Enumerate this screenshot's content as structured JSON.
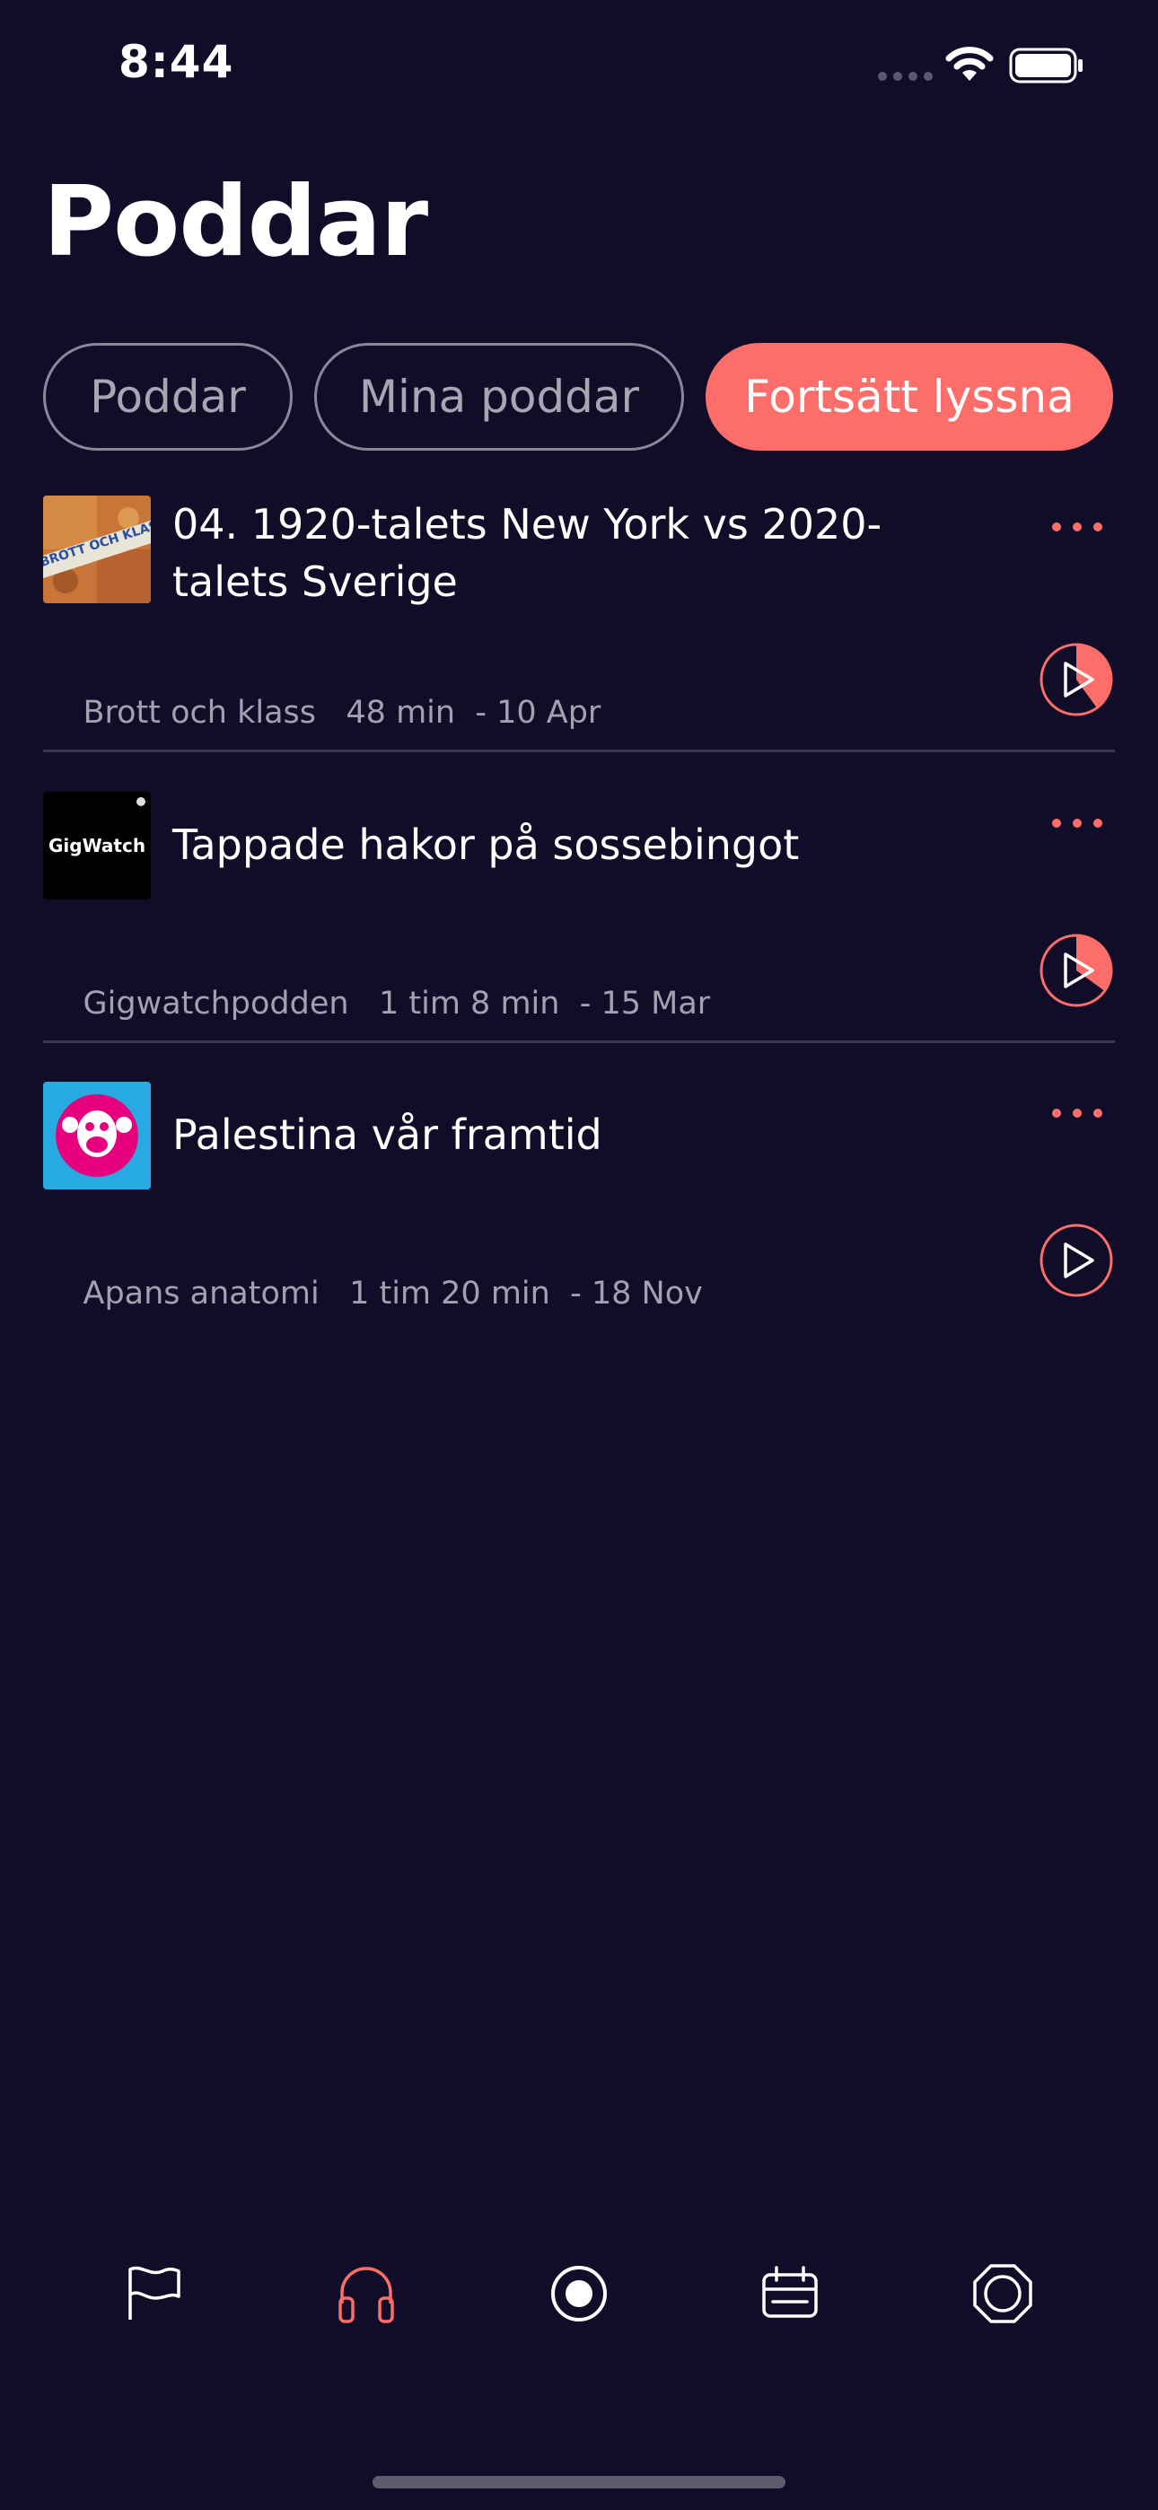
{
  "status_bar": {
    "time": "8:44",
    "icons": [
      "cellular-dots-icon",
      "wifi-icon",
      "battery-icon"
    ]
  },
  "page": {
    "title": "Poddar"
  },
  "filters": [
    {
      "label": "Poddar",
      "active": false
    },
    {
      "label": "Mina poddar",
      "active": false
    },
    {
      "label": "Fortsätt lyssna",
      "active": true
    }
  ],
  "episodes": [
    {
      "title": "04. 1920-talets New York vs 2020-talets Sverige",
      "show": "Brott och klass",
      "duration": "48 min",
      "date": "- 10 Apr",
      "thumb_text": "BROTT OCH KLASS",
      "progress": 0.4
    },
    {
      "title": "Tappade hakor på sossebingot",
      "show": "Gigwatchpodden",
      "duration": "1 tim 8 min",
      "date": "- 15 Mar",
      "thumb_text": "GigWatch",
      "progress": 0.35
    },
    {
      "title": "Palestina vår framtid",
      "show": "Apans anatomi",
      "duration": "1 tim 20 min",
      "date": "- 18 Nov",
      "progress": 0.0
    }
  ],
  "tabbar": {
    "items": [
      {
        "icon": "flag-icon",
        "active": false
      },
      {
        "icon": "headphones-icon",
        "active": true
      },
      {
        "icon": "record-icon",
        "active": false
      },
      {
        "icon": "calendar-icon",
        "active": false
      },
      {
        "icon": "octagon-icon",
        "active": false
      }
    ]
  },
  "colors": {
    "background": "#110d29",
    "accent": "#fd6e6a",
    "text_secondary": "#a3a1b0",
    "divider": "#3a3752"
  }
}
